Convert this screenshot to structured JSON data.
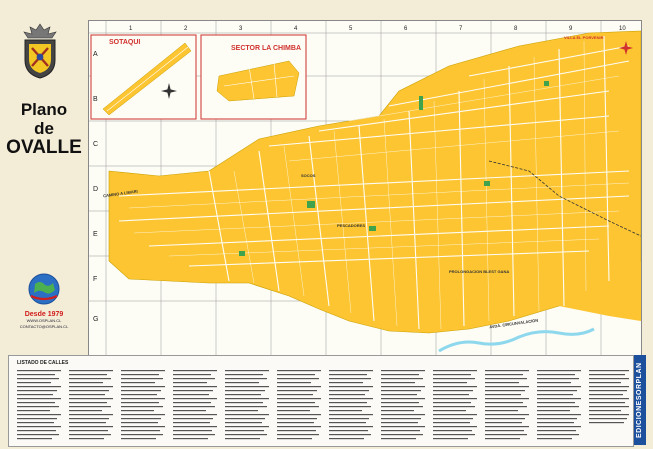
{
  "title": {
    "line1": "Plano",
    "line2": "de",
    "line3": "OVALLE"
  },
  "publisher": {
    "since": "Desde 1979",
    "url1": "WWW.OSPLAN.CL",
    "url2": "CONTACTO@OSPLAN.CL",
    "side_label": "EDICIONESORPLAN"
  },
  "grid": {
    "columns": [
      "1",
      "2",
      "3",
      "4",
      "5",
      "6",
      "7",
      "8",
      "9",
      "10"
    ],
    "rows": [
      "A",
      "B",
      "C",
      "D",
      "E",
      "F",
      "G"
    ]
  },
  "insets": [
    {
      "name": "SOTAQUI"
    },
    {
      "name": "SECTOR LA CHIMBA"
    }
  ],
  "labels": {
    "socos": "SOCOS",
    "pescadores": "PESCADORES",
    "prolongacion": "PROLONGACION BLEST GANA",
    "circunvalacion": "AVDA. CIRCUNVALACION",
    "camino_limari": "CAMINO A LIMARI",
    "villa": "VILLA EL PORVENIR"
  },
  "streets_header": "LISTADO DE CALLES",
  "colors": {
    "blocks": "#fcc531",
    "water": "#8ed8ee",
    "accent": "#d0312d",
    "band": "#1c4f9c"
  }
}
